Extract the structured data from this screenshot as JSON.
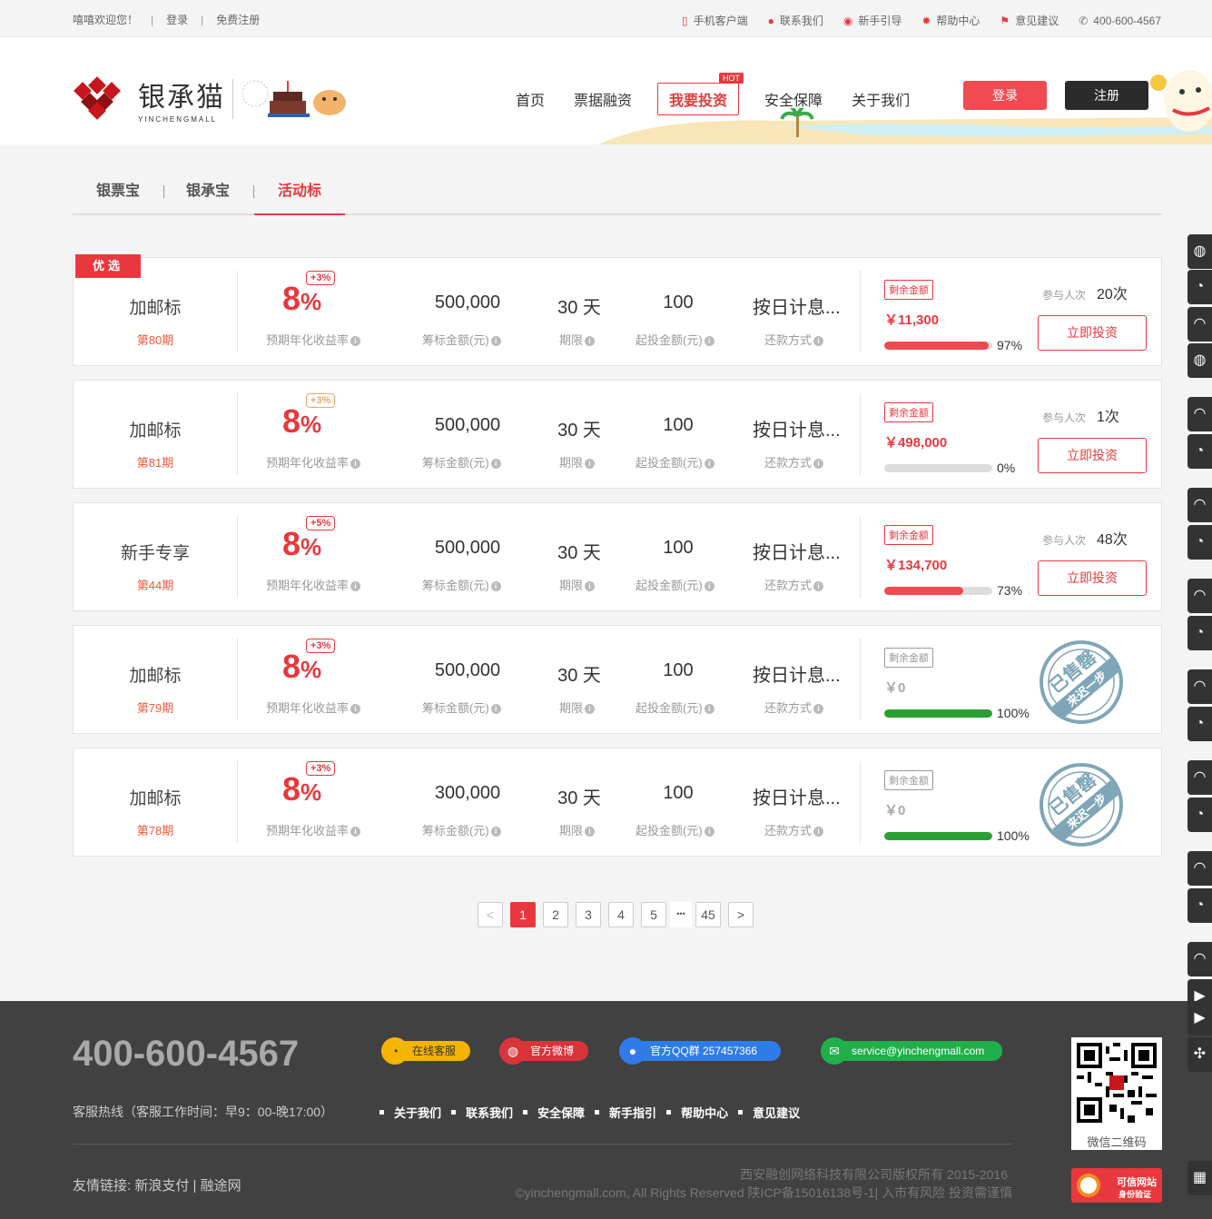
{
  "topbar": {
    "welcome": "嘻嘻欢迎您！",
    "login": "登录",
    "register": "免费注册",
    "links": [
      {
        "icon": "mobile-icon",
        "label": "手机客户端"
      },
      {
        "icon": "location-icon",
        "label": "联系我们"
      },
      {
        "icon": "guide-icon",
        "label": "新手引导"
      },
      {
        "icon": "help-icon",
        "label": "帮助中心"
      },
      {
        "icon": "flag-icon",
        "label": "意见建议"
      }
    ],
    "phone": "400-600-4567"
  },
  "header": {
    "logo_cn": "银承猫",
    "logo_en": "YINCHENGMALL",
    "nav": [
      {
        "label": "首页"
      },
      {
        "label": "票据融资"
      },
      {
        "label": "我要投资",
        "hot": "HOT"
      },
      {
        "label": "安全保障"
      },
      {
        "label": "关于我们"
      }
    ],
    "login_btn": "登录",
    "register_btn": "注册"
  },
  "tabs": [
    "银票宝",
    "银承宝",
    "活动标"
  ],
  "active_tab": "活动标",
  "card_labels": {
    "rate": "预期年化收益率",
    "amount": "筹标金额(元)",
    "term": "期限",
    "min": "起投金额(元)",
    "repay": "还款方式",
    "remaining": "剩余金额",
    "participants": "参与人次",
    "invest_btn": "立即投资",
    "selected_badge": "优选"
  },
  "products": [
    {
      "name": "加邮标",
      "period": "第80期",
      "rate": "8",
      "pct_sign": "%",
      "bonus": "+3%",
      "bonus_style": "red",
      "amount": "500,000",
      "term": "30 天",
      "min": "100",
      "repay": "按日计息...",
      "remaining": "￥11,300",
      "progress": 97,
      "progress_text": "97%",
      "participants": "20次",
      "status": "open",
      "selected": true
    },
    {
      "name": "加邮标",
      "period": "第81期",
      "rate": "8",
      "pct_sign": "%",
      "bonus": "+3%",
      "bonus_style": "orange",
      "amount": "500,000",
      "term": "30 天",
      "min": "100",
      "repay": "按日计息...",
      "remaining": "￥498,000",
      "progress": 0,
      "progress_text": "0%",
      "participants": "1次",
      "status": "open",
      "selected": false
    },
    {
      "name": "新手专享",
      "period": "第44期",
      "rate": "8",
      "pct_sign": "%",
      "bonus": "+5%",
      "bonus_style": "red",
      "amount": "500,000",
      "term": "30 天",
      "min": "100",
      "repay": "按日计息...",
      "remaining": "￥134,700",
      "progress": 73,
      "progress_text": "73%",
      "participants": "48次",
      "status": "open",
      "selected": false
    },
    {
      "name": "加邮标",
      "period": "第79期",
      "rate": "8",
      "pct_sign": "%",
      "bonus": "+3%",
      "bonus_style": "red",
      "amount": "500,000",
      "term": "30 天",
      "min": "100",
      "repay": "按日计息...",
      "remaining": "￥0",
      "progress": 100,
      "progress_text": "100%",
      "participants": "",
      "status": "sold",
      "selected": false
    },
    {
      "name": "加邮标",
      "period": "第78期",
      "rate": "8",
      "pct_sign": "%",
      "bonus": "+3%",
      "bonus_style": "red",
      "amount": "300,000",
      "term": "30 天",
      "min": "100",
      "repay": "按日计息...",
      "remaining": "￥0",
      "progress": 100,
      "progress_text": "100%",
      "participants": "",
      "status": "sold",
      "selected": false
    }
  ],
  "stamp": {
    "line1": "已售罄",
    "line2": "来迟一步"
  },
  "pagination": {
    "prev": "<",
    "pages": [
      "1",
      "2",
      "3",
      "4",
      "5"
    ],
    "dots": "•••",
    "last": "45",
    "next": ">",
    "current": "1"
  },
  "footer": {
    "phone": "400-600-4567",
    "hotline": "客服热线（客服工作时间：早9：00-晚17:00）",
    "pills": [
      {
        "icon": "chat-icon",
        "label": "在线客服",
        "color": "#f5b400"
      },
      {
        "icon": "weibo-icon",
        "label": "官方微博",
        "color": "#d9343a"
      },
      {
        "icon": "qq-icon",
        "label": "官方QQ群 257457366",
        "color": "#2f7be8"
      },
      {
        "icon": "mail-icon",
        "label": "service@yinchengmall.com",
        "color": "#1fb04a"
      }
    ],
    "links": [
      "关于我们",
      "联系我们",
      "安全保障",
      "新手指引",
      "帮助中心",
      "意见建议"
    ],
    "friend": "友情链接: 新浪支付 | 融途网",
    "copy1": "西安融创网络科技有限公司版权所有   2015-2016",
    "copy2": "©yinchengmall.com, All Rights Reserved 陕ICP备15016138号-1| 入市有风险 投资需谨慎",
    "qr_caption": "微信二维码",
    "trust_line1": "可信网站",
    "trust_line2": "身份验证"
  },
  "colors": {
    "accent": "#e8383d",
    "green": "#2aa033",
    "dark": "#414141"
  }
}
